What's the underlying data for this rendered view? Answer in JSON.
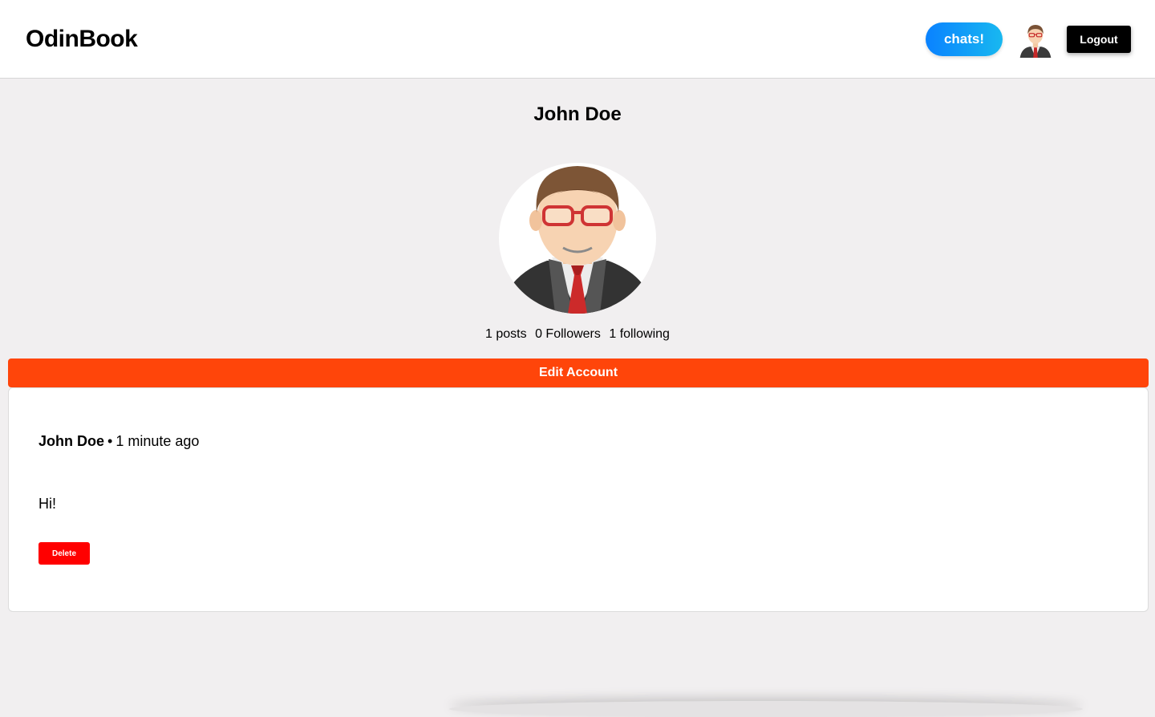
{
  "header": {
    "brand": "OdinBook",
    "chats_label": "chats!",
    "avatar_icon": "user-avatar-icon",
    "logout_label": "Logout"
  },
  "profile": {
    "name": "John Doe",
    "avatar_icon": "businessman-avatar-icon",
    "stats": {
      "posts": "1 posts",
      "followers": "0 Followers",
      "following": "1 following"
    },
    "edit_label": "Edit Account"
  },
  "posts": [
    {
      "author": "John Doe",
      "separator": "•",
      "time": "1 minute ago",
      "body": "Hi!",
      "delete_label": "Delete"
    }
  ],
  "colors": {
    "background": "#f1eff0",
    "edit_button": "#ff450a",
    "delete_button": "#ff0000",
    "chats_gradient_start": "#0a82ff",
    "chats_gradient_end": "#18b8f0",
    "logout_button": "#000000"
  }
}
